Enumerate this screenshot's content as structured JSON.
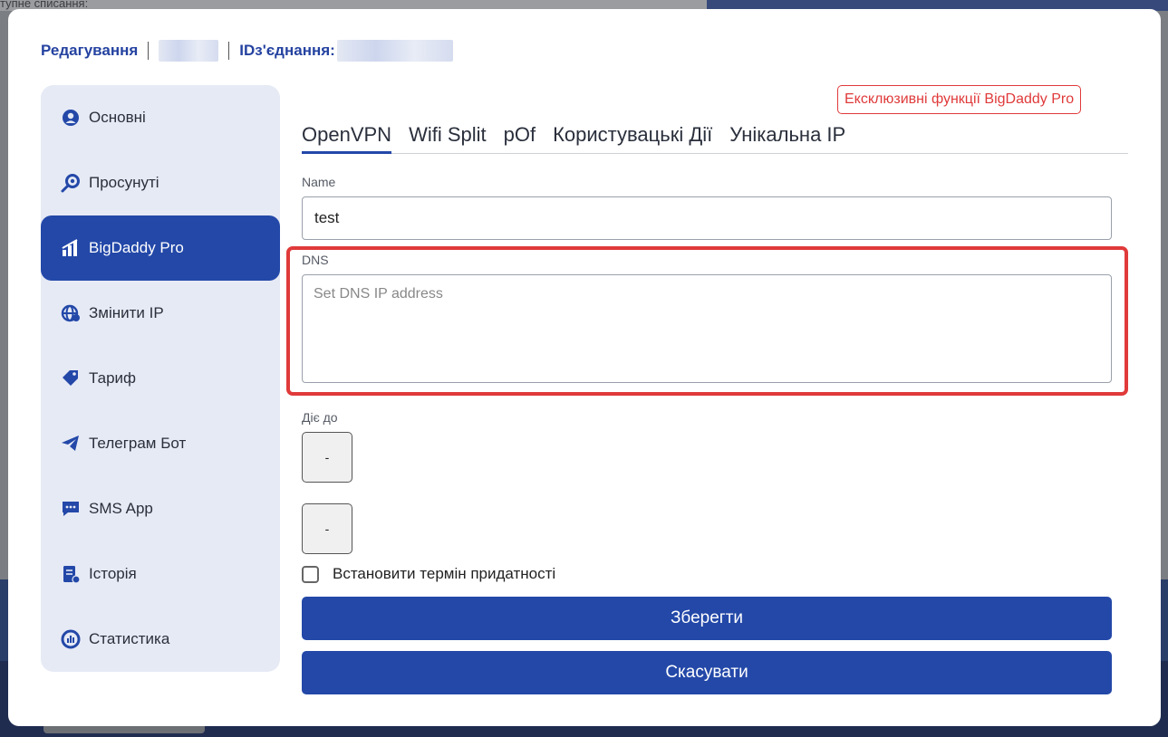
{
  "background": {
    "partial_text": "тупне списання:"
  },
  "header": {
    "edit_label": "Редагування",
    "connection_id_label": "IDз'єднання:"
  },
  "sidebar": {
    "items": [
      {
        "label": "Основні",
        "icon": "user-circle-icon"
      },
      {
        "label": "Просунуті",
        "icon": "gear-search-icon"
      },
      {
        "label": "BigDaddy Pro",
        "icon": "chart-bars-icon",
        "active": true
      },
      {
        "label": "Змінити IP",
        "icon": "globe-pin-icon"
      },
      {
        "label": "Тариф",
        "icon": "tag-icon"
      },
      {
        "label": "Телеграм Бот",
        "icon": "telegram-icon"
      },
      {
        "label": "SMS App",
        "icon": "chat-bubble-icon"
      },
      {
        "label": "Історія",
        "icon": "document-icon"
      },
      {
        "label": "Статистика",
        "icon": "pie-chart-icon"
      }
    ]
  },
  "pro_badge": "Ексклюзивні функції BigDaddy Pro",
  "tabs": [
    {
      "label": "OpenVPN",
      "active": true
    },
    {
      "label": "Wifi Split"
    },
    {
      "label": "pOf"
    },
    {
      "label": "Користувацькі Дії"
    },
    {
      "label": "Унікальна IP"
    }
  ],
  "form": {
    "name_label": "Name",
    "name_value": "test",
    "dns_label": "DNS",
    "dns_placeholder": "Set DNS IP address",
    "valid_until_label": "Діє до",
    "date_button_1": "-",
    "date_button_2": "-",
    "expiry_checkbox_label": "Встановити термін придатності",
    "save_label": "Зберегти",
    "cancel_label": "Скасувати"
  },
  "colors": {
    "accent": "#2348a8",
    "highlight": "#e03a3a",
    "sidebar_bg": "#e6eaf5"
  }
}
